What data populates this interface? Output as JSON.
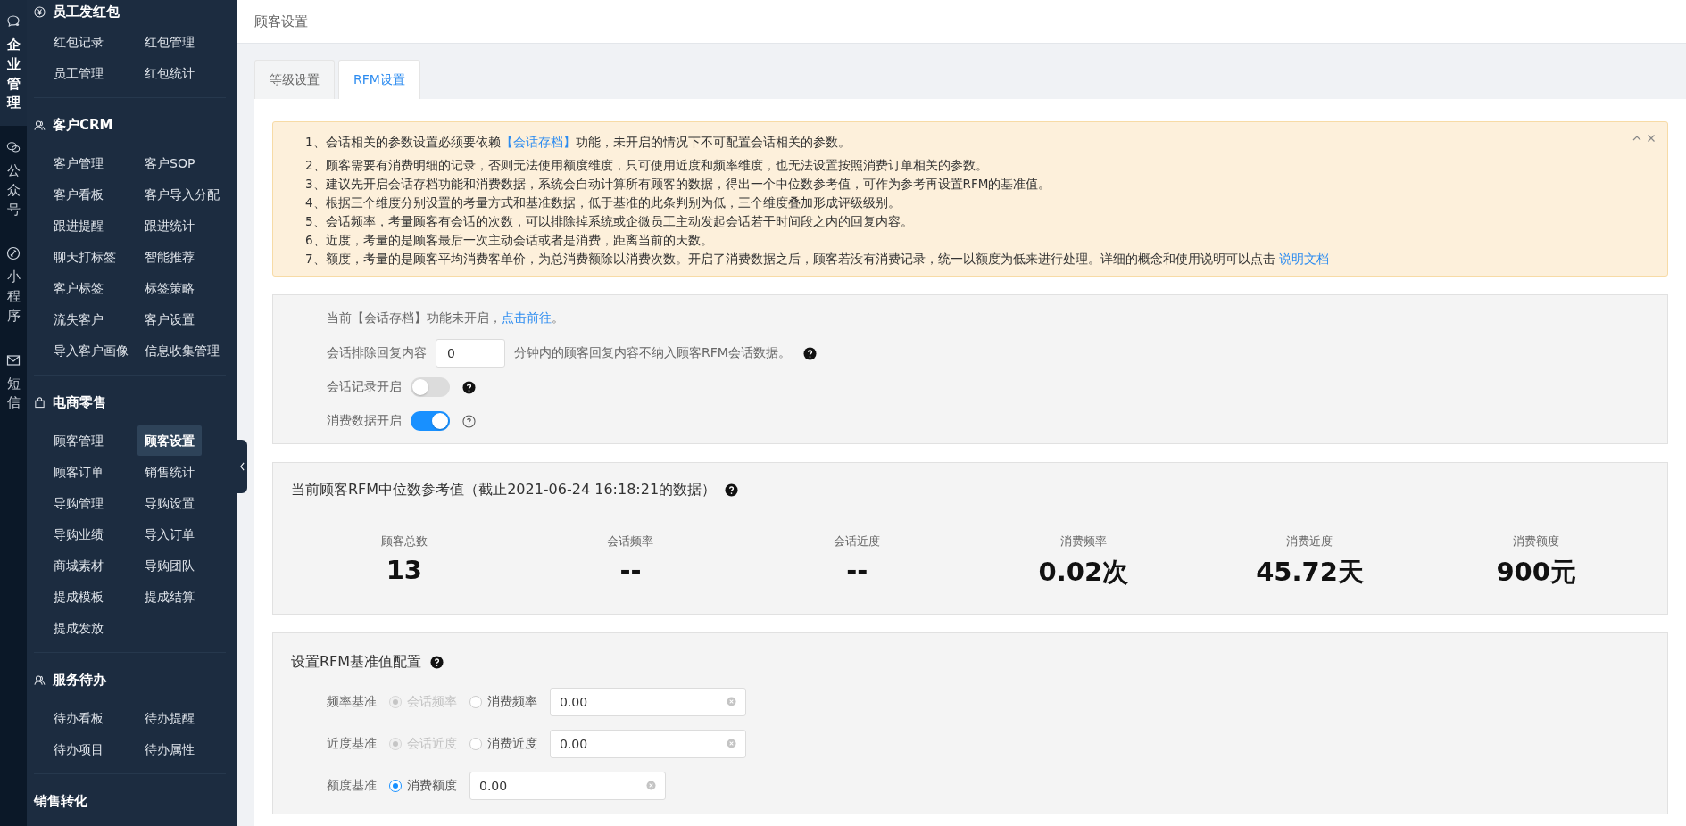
{
  "rail": [
    {
      "label": "企业管理",
      "kind": "chat",
      "selected": true
    },
    {
      "label": "公众号",
      "kind": "wechat",
      "selected": false
    },
    {
      "label": "小程序",
      "kind": "link",
      "selected": false
    },
    {
      "label": "短信",
      "kind": "mail",
      "selected": false
    }
  ],
  "nav": [
    {
      "title": "员工发红包",
      "kind": "yen",
      "items": [
        {
          "label": "红包记录",
          "selected": false
        },
        {
          "label": "红包管理",
          "selected": false
        },
        {
          "label": "员工管理",
          "selected": false
        },
        {
          "label": "红包统计",
          "selected": false
        }
      ]
    },
    {
      "title": "客户CRM",
      "kind": "people",
      "items": [
        {
          "label": "客户管理",
          "selected": false
        },
        {
          "label": "客户SOP",
          "selected": false
        },
        {
          "label": "客户看板",
          "selected": false
        },
        {
          "label": "客户导入分配",
          "selected": false
        },
        {
          "label": "跟进提醒",
          "selected": false
        },
        {
          "label": "跟进统计",
          "selected": false
        },
        {
          "label": "聊天打标签",
          "selected": false
        },
        {
          "label": "智能推荐",
          "selected": false
        },
        {
          "label": "客户标签",
          "selected": false
        },
        {
          "label": "标签策略",
          "selected": false
        },
        {
          "label": "流失客户",
          "selected": false
        },
        {
          "label": "客户设置",
          "selected": false
        },
        {
          "label": "导入客户画像",
          "selected": false
        },
        {
          "label": "信息收集管理",
          "selected": false
        }
      ]
    },
    {
      "title": "电商零售",
      "kind": "bag",
      "items": [
        {
          "label": "顾客管理",
          "selected": false
        },
        {
          "label": "顾客设置",
          "selected": true
        },
        {
          "label": "顾客订单",
          "selected": false
        },
        {
          "label": "销售统计",
          "selected": false
        },
        {
          "label": "导购管理",
          "selected": false
        },
        {
          "label": "导购设置",
          "selected": false
        },
        {
          "label": "导购业绩",
          "selected": false
        },
        {
          "label": "导入订单",
          "selected": false
        },
        {
          "label": "商城素材",
          "selected": false
        },
        {
          "label": "导购团队",
          "selected": false
        },
        {
          "label": "提成模板",
          "selected": false
        },
        {
          "label": "提成结算",
          "selected": false
        },
        {
          "label": "提成发放",
          "selected": false
        }
      ]
    },
    {
      "title": "服务待办",
      "kind": "people",
      "items": [
        {
          "label": "待办看板",
          "selected": false
        },
        {
          "label": "待办提醒",
          "selected": false
        },
        {
          "label": "待办项目",
          "selected": false
        },
        {
          "label": "待办属性",
          "selected": false
        }
      ]
    },
    {
      "title": "销售转化"
    }
  ],
  "page_title": "顾客设置",
  "tabs": [
    {
      "label": "等级设置",
      "selected": false
    },
    {
      "label": "RFM设置",
      "selected": true
    }
  ],
  "alert": {
    "lines": [
      [
        {
          "text": "1、会话相关的参数设置必须要依赖",
          "kind": "text"
        },
        {
          "text": "【会话存档】",
          "kind": "link"
        },
        {
          "text": "功能，未开启的情况下不可配置会话相关的参数。",
          "kind": "text"
        }
      ],
      [
        {
          "text": "2、顾客需要有消费明细的记录，否则无法使用额度维度，只可使用近度和频率维度，也无法设置按照消费订单相关的参数。",
          "kind": "text"
        }
      ],
      [
        {
          "text": "3、建议先开启会话存档功能和消费数据，系统会自动计算所有顾客的数据，得出一个中位数参考值，可作为参考再设置RFM的基准值。",
          "kind": "text"
        }
      ],
      [
        {
          "text": "4、根据三个维度分别设置的考量方式和基准数据，低于基准的此条判别为低，三个维度叠加形成评级级别。",
          "kind": "text"
        }
      ],
      [
        {
          "text": "5、会话频率，考量顾客有会话的次数，可以排除掉系统或企微员工主动发起会话若干时间段之内的回复内容。",
          "kind": "text"
        }
      ],
      [
        {
          "text": "6、近度，考量的是顾客最后一次主动会话或者是消费，距离当前的天数。",
          "kind": "text"
        }
      ],
      [
        {
          "text": "7、额度，考量的是顾客平均消费客单价，为总消费额除以消费次数。开启了消费数据之后，顾客若没有消费记录，统一以额度为低来进行处理。详细的概念和使用说明可以点击 ",
          "kind": "text"
        },
        {
          "text": "说明文档",
          "kind": "link"
        }
      ]
    ]
  },
  "settings": {
    "notice": [
      {
        "text": "当前【会话存档】功能未开启，",
        "kind": "text"
      },
      {
        "text": "点击前往",
        "kind": "link"
      },
      {
        "text": "。",
        "kind": "text"
      }
    ],
    "exclude": {
      "label": "会话排除回复内容",
      "value": "0",
      "suffix": "分钟内的顾客回复内容不纳入顾客RFM会话数据。"
    },
    "toggles": [
      {
        "label": "会话记录开启",
        "on": false,
        "kind": "filled-help"
      },
      {
        "label": "消费数据开启",
        "on": true,
        "kind": "outline-help"
      }
    ]
  },
  "stats": {
    "title": "当前顾客RFM中位数参考值（截止2021-06-24 16:18:21的数据）",
    "items": [
      {
        "label": "顾客总数",
        "value": "13"
      },
      {
        "label": "会话频率",
        "value": "--"
      },
      {
        "label": "会话近度",
        "value": "--"
      },
      {
        "label": "消费频率",
        "value": "0.02次"
      },
      {
        "label": "消费近度",
        "value": "45.72天"
      },
      {
        "label": "消费额度",
        "value": "900元"
      }
    ]
  },
  "config": {
    "title": "设置RFM基准值配置",
    "rows": [
      {
        "label": "频率基准",
        "options": [
          {
            "label": "会话频率",
            "selected": true,
            "disabled": true
          },
          {
            "label": "消费频率",
            "selected": false,
            "disabled": false
          }
        ],
        "value": "0.00"
      },
      {
        "label": "近度基准",
        "options": [
          {
            "label": "会话近度",
            "selected": true,
            "disabled": true
          },
          {
            "label": "消费近度",
            "selected": false,
            "disabled": false
          }
        ],
        "value": "0.00"
      },
      {
        "label": "额度基准",
        "options": [
          {
            "label": "消费额度",
            "selected": true,
            "disabled": false
          }
        ],
        "value": "0.00"
      }
    ]
  }
}
